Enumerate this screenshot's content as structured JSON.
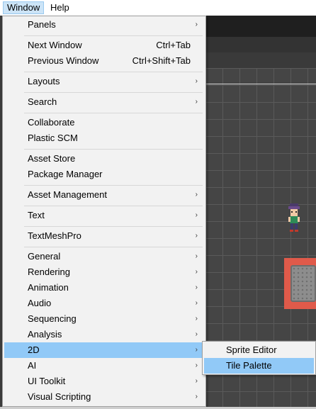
{
  "menubar": {
    "window_label": "Window",
    "help_label": "Help"
  },
  "menu": {
    "items": [
      {
        "label": "Panels",
        "shortcut": "",
        "arrow": "›"
      },
      {
        "label": "Next Window",
        "shortcut": "Ctrl+Tab",
        "arrow": ""
      },
      {
        "label": "Previous Window",
        "shortcut": "Ctrl+Shift+Tab",
        "arrow": ""
      },
      {
        "label": "Layouts",
        "shortcut": "",
        "arrow": "›"
      },
      {
        "label": "Search",
        "shortcut": "",
        "arrow": "›"
      },
      {
        "label": "Collaborate",
        "shortcut": "",
        "arrow": ""
      },
      {
        "label": "Plastic SCM",
        "shortcut": "",
        "arrow": ""
      },
      {
        "label": "Asset Store",
        "shortcut": "",
        "arrow": ""
      },
      {
        "label": "Package Manager",
        "shortcut": "",
        "arrow": ""
      },
      {
        "label": "Asset Management",
        "shortcut": "",
        "arrow": "›"
      },
      {
        "label": "Text",
        "shortcut": "",
        "arrow": "›"
      },
      {
        "label": "TextMeshPro",
        "shortcut": "",
        "arrow": "›"
      },
      {
        "label": "General",
        "shortcut": "",
        "arrow": "›"
      },
      {
        "label": "Rendering",
        "shortcut": "",
        "arrow": "›"
      },
      {
        "label": "Animation",
        "shortcut": "",
        "arrow": "›"
      },
      {
        "label": "Audio",
        "shortcut": "",
        "arrow": "›"
      },
      {
        "label": "Sequencing",
        "shortcut": "",
        "arrow": "›"
      },
      {
        "label": "Analysis",
        "shortcut": "",
        "arrow": "›"
      },
      {
        "label": "2D",
        "shortcut": "",
        "arrow": "›"
      },
      {
        "label": "AI",
        "shortcut": "",
        "arrow": "›"
      },
      {
        "label": "UI Toolkit",
        "shortcut": "",
        "arrow": "›"
      },
      {
        "label": "Visual Scripting",
        "shortcut": "",
        "arrow": "›"
      }
    ]
  },
  "submenu_2d": {
    "items": [
      {
        "label": "Sprite Editor"
      },
      {
        "label": "Tile Palette"
      }
    ]
  },
  "colors": {
    "highlight": "#91c9f7",
    "menu_bg": "#f2f2f2",
    "scene_bg": "#454545",
    "tile_red": "#e05a4a"
  },
  "icons": {
    "submenu_arrow": "chevron-right-icon"
  }
}
